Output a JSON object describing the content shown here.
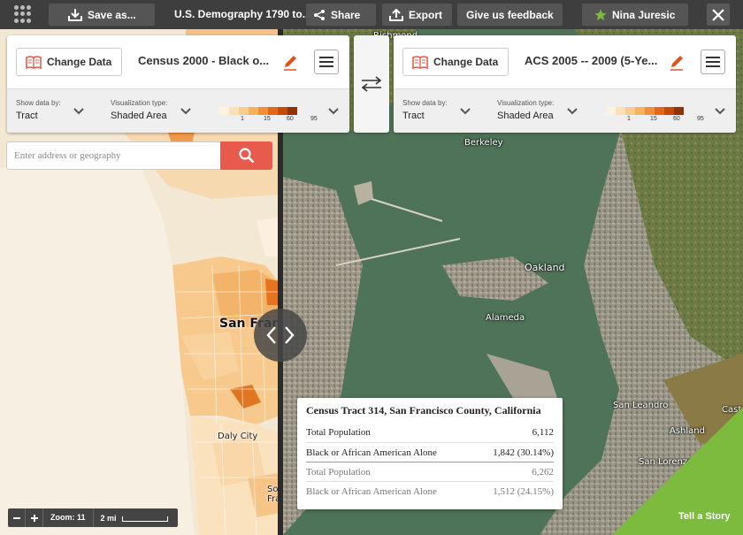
{
  "topbar": {
    "save_label": "Save as...",
    "title": "U.S. Demography 1790 to...",
    "share_label": "Share",
    "export_label": "Export",
    "feedback_label": "Give us feedback",
    "user_label": "Nina Juresic"
  },
  "left_panel": {
    "change_data_label": "Change Data",
    "dataset_title": "Census 2000 - Black o...",
    "show_data_by_label": "Show data by:",
    "show_data_by_value": "Tract",
    "viz_type_label": "Visualization type:",
    "viz_type_value": "Shaded Area",
    "legend_ticks": [
      "1",
      "15",
      "60",
      "95"
    ]
  },
  "right_panel": {
    "change_data_label": "Change Data",
    "dataset_title": "ACS 2005 -- 2009 (5-Ye...",
    "show_data_by_label": "Show data by:",
    "show_data_by_value": "Tract",
    "viz_type_label": "Visualization type:",
    "viz_type_value": "Shaded Area",
    "legend_ticks": [
      "1",
      "15",
      "60",
      "95"
    ]
  },
  "legend_colors": [
    "#fdf1e0",
    "#fbe0b9",
    "#f8cb8e",
    "#f5b062",
    "#f08f3a",
    "#e2691b",
    "#c24b0c",
    "#8f3307"
  ],
  "search": {
    "placeholder": "Enter address or geography"
  },
  "map_labels": {
    "san_francisco": "San Francisco",
    "daly_city": "Daly City",
    "south_sf": "South San Francisco",
    "berkeley": "Berkeley",
    "oakland": "Oakland",
    "alameda": "Alameda",
    "san_leandro": "San Leandro",
    "ashland": "Ashland",
    "san_lorenzo": "San Lorenzo",
    "richmond": "Richmond",
    "castro_valley": "Castro Valley"
  },
  "tooltip": {
    "title": "Census Tract 314, San Francisco County, California",
    "rows": [
      {
        "label": "Total Population",
        "value": "6,112"
      },
      {
        "label": "Black or African American Alone",
        "value": "1,842 (30.14%)"
      },
      {
        "label": "Total Population",
        "value": "6,262"
      },
      {
        "label": "Black or African American Alone",
        "value": "1,512 (24.15%)"
      }
    ]
  },
  "zoom": {
    "zoom_label": "Zoom: 11",
    "scale_label": "2 mi"
  },
  "story": {
    "label": "Tell a Story"
  },
  "colors": {
    "accent_red": "#e85b4c",
    "story_green": "#7dbb3f",
    "topbar_bg": "#3e3e3e",
    "pencil_orange": "#e0531f"
  }
}
